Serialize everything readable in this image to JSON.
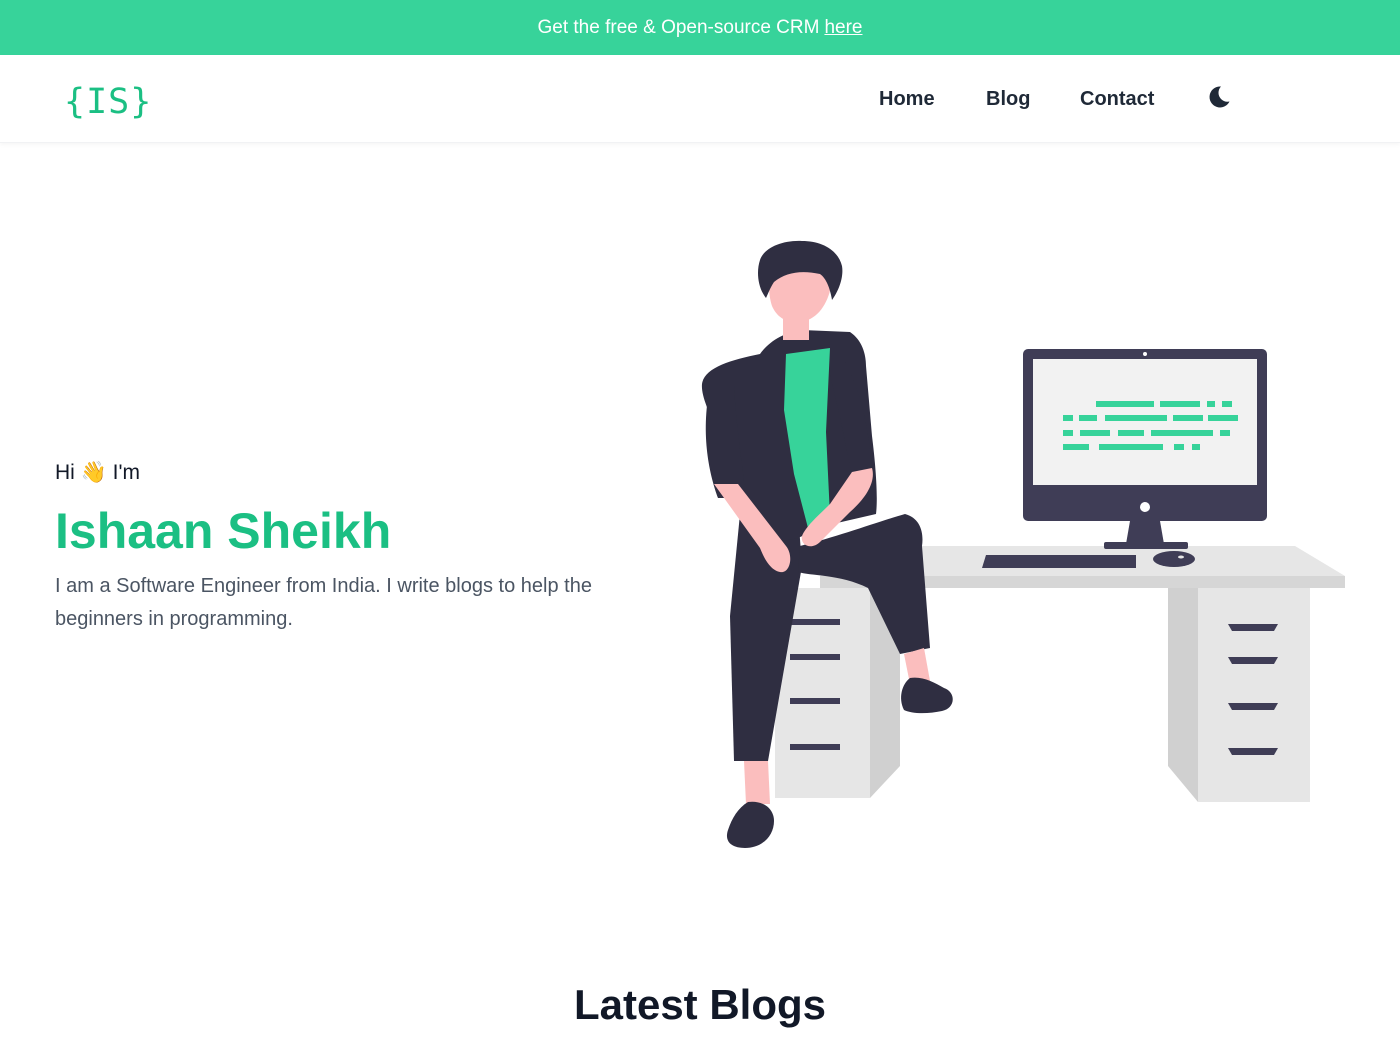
{
  "banner": {
    "text": "Get the free & Open-source CRM",
    "link_label": "here"
  },
  "header": {
    "logo_text": "{IS}",
    "nav": {
      "home": "Home",
      "blog": "Blog",
      "contact": "Contact"
    },
    "theme_toggle_icon": "moon-icon"
  },
  "hero": {
    "greeting": "Hi 👋 I'm",
    "name": "Ishaan Sheikh",
    "bio": "I am a Software Engineer from India. I write blogs to help the beginners in programming.",
    "illustration_icon": "developer-at-desk-illustration"
  },
  "latest_blogs": {
    "title": "Latest Blogs"
  },
  "colors": {
    "accent": "#37d39a",
    "accent_text": "#1bbf83",
    "dark": "#2f2e41",
    "skin": "#fbbebe",
    "desk": "#e6e6e6"
  }
}
